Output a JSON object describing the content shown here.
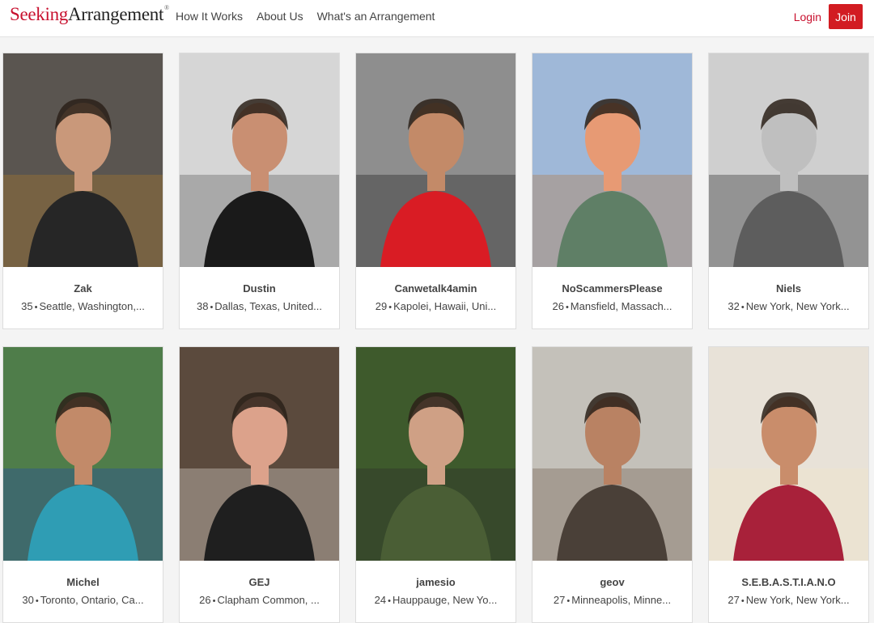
{
  "header": {
    "logo_part1": "Seeking",
    "logo_part2": "Arrangement",
    "logo_mark": "®",
    "nav": [
      "How It Works",
      "About Us",
      "What's an Arrangement"
    ],
    "login_label": "Login",
    "join_label": "Join"
  },
  "profiles": [
    {
      "name": "Zak",
      "age": "35",
      "location": "Seattle, Washington,...",
      "bg": "#5a5550",
      "skin": "#c9987a",
      "shirt": "#262626",
      "accent": "#b07a2a"
    },
    {
      "name": "Dustin",
      "age": "38",
      "location": "Dallas, Texas, United...",
      "bg": "#d6d6d6",
      "skin": "#c98f72",
      "shirt": "#1a1a1a",
      "accent": "#555555"
    },
    {
      "name": "Canwetalk4amin",
      "age": "29",
      "location": "Kapolei, Hawaii, Uni...",
      "bg": "#8e8e8e",
      "skin": "#c38a68",
      "shirt": "#d91c24",
      "accent": "#1a1a1a"
    },
    {
      "name": "NoScammersPlease",
      "age": "26",
      "location": "Mansfield, Massach...",
      "bg": "#9fb8d8",
      "skin": "#e79a74",
      "shirt": "#5f7f66",
      "accent": "#b5763f"
    },
    {
      "name": "Niels",
      "age": "32",
      "location": "New York, New York...",
      "bg": "#cfcfcf",
      "skin": "#bfbfbf",
      "shirt": "#5d5d5d",
      "accent": "#222222"
    },
    {
      "name": "Michel",
      "age": "30",
      "location": "Toronto, Ontario, Ca...",
      "bg": "#4f7d4a",
      "skin": "#c28a69",
      "shirt": "#2f9db4",
      "accent": "#2148a8"
    },
    {
      "name": "GEJ",
      "age": "26",
      "location": "Clapham Common, ...",
      "bg": "#5b4a3d",
      "skin": "#dca28b",
      "shirt": "#1f1f1f",
      "accent": "#e6e0da"
    },
    {
      "name": "jamesio",
      "age": "24",
      "location": "Hauppauge, New Yo...",
      "bg": "#3e5a2c",
      "skin": "#cfa085",
      "shirt": "#4a5e35",
      "accent": "#2c2c2c"
    },
    {
      "name": "geov",
      "age": "27",
      "location": "Minneapolis, Minne...",
      "bg": "#c4c1ba",
      "skin": "#b98263",
      "shirt": "#4a4038",
      "accent": "#6d5a48"
    },
    {
      "name": "S.E.B.A.S.T.I.A.N.O",
      "age": "27",
      "location": "New York, New York...",
      "bg": "#e8e2d8",
      "skin": "#c98d6b",
      "shirt": "#a8213a",
      "accent": "#f2e6c8"
    }
  ]
}
